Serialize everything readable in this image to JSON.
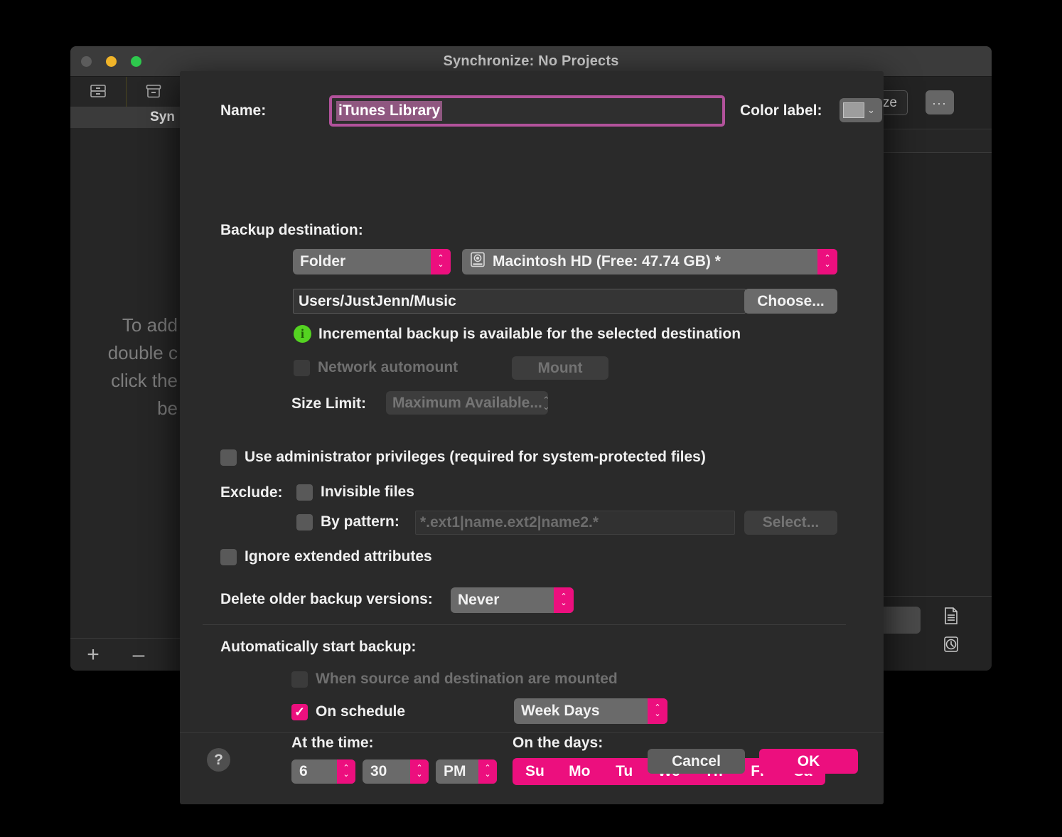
{
  "window": {
    "title": "Synchronize: No Projects",
    "traffic_lights": [
      "close",
      "minimize",
      "maximize"
    ]
  },
  "sidebar": {
    "toolbar_icons": [
      "drawer-icon",
      "archive-icon"
    ],
    "header_label": "Syn",
    "empty_message": "To add\ndouble c\nclick the\nbe",
    "add_label": "+",
    "remove_label": "–"
  },
  "background_toolbar": {
    "synchronize_label": "ronize",
    "more_label": "...",
    "log_icon": "document-icon",
    "history_icon": "clock-icon"
  },
  "dialog": {
    "name": {
      "label": "Name:",
      "value": "iTunes Library"
    },
    "color_label": {
      "label": "Color label:",
      "swatch_color": "#9d9d9d",
      "chevron": "⌄"
    },
    "backup_destination": {
      "label": "Backup destination:",
      "type_value": "Folder",
      "disk_icon": "hard-drive-icon",
      "disk_value": "Macintosh HD (Free: 47.74 GB) *",
      "path_value": "Users/JustJenn/Music",
      "choose_label": "Choose...",
      "incremental_notice": "Incremental backup is available for the selected destination",
      "incremental_icon": "info-icon",
      "network_automount_label": "Network automount",
      "network_automount_checked": false,
      "mount_label": "Mount",
      "size_limit_label": "Size Limit:",
      "size_limit_value": "Maximum Available..."
    },
    "options": {
      "admin_label": "Use administrator privileges (required for system-protected files)",
      "admin_checked": false,
      "exclude_label": "Exclude:",
      "invisible_label": "Invisible files",
      "invisible_checked": false,
      "by_pattern_label": "By pattern:",
      "by_pattern_checked": false,
      "pattern_placeholder": "*.ext1|name.ext2|name2.*",
      "select_label": "Select...",
      "ignore_xattr_label": "Ignore extended attributes",
      "ignore_xattr_checked": false,
      "delete_versions_label": "Delete older backup versions:",
      "delete_versions_value": "Never"
    },
    "schedule": {
      "section_label": "Automatically start backup:",
      "when_mounted_label": "When source and destination are mounted",
      "when_mounted_checked": false,
      "on_schedule_label": "On schedule",
      "on_schedule_checked": true,
      "frequency_value": "Week Days",
      "at_the_time_label": "At the time:",
      "hour": "6",
      "minute": "30",
      "ampm": "PM",
      "on_the_days_label": "On the days:",
      "days": [
        {
          "label": "Su",
          "selected": true
        },
        {
          "label": "Mo",
          "selected": true
        },
        {
          "label": "Tu",
          "selected": true
        },
        {
          "label": "We",
          "selected": true
        },
        {
          "label": "Th",
          "selected": true
        },
        {
          "label": "Fr",
          "selected": true
        },
        {
          "label": "Sa",
          "selected": true
        }
      ]
    },
    "footer": {
      "help_label": "?",
      "cancel_label": "Cancel",
      "ok_label": "OK"
    }
  },
  "colors": {
    "accent_pink": "#ec0f7e",
    "field_focus_border": "#b2529b",
    "selection": "#8f5780",
    "info_green": "#54d321"
  }
}
